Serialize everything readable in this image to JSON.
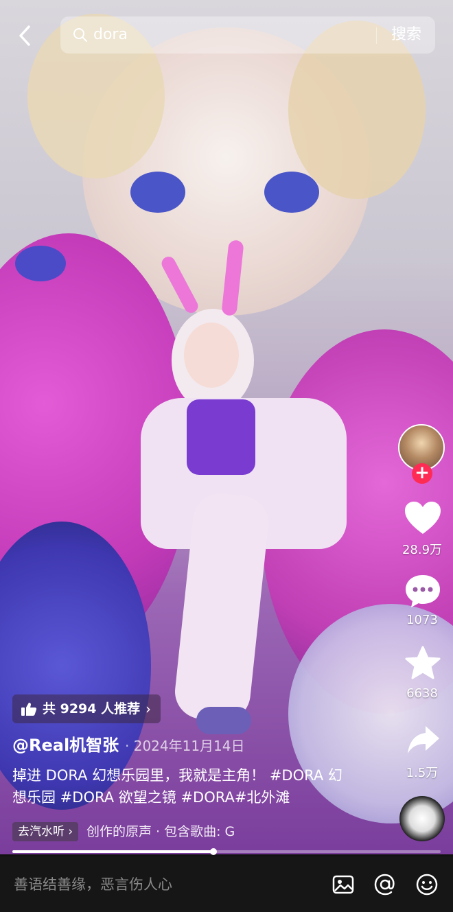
{
  "search": {
    "query": "dora",
    "button": "搜索"
  },
  "rail": {
    "likes": "28.9万",
    "comments": "1073",
    "favorites": "6638",
    "shares": "1.5万"
  },
  "recommend": {
    "label": "共 9294 人推荐"
  },
  "post": {
    "author": "@Real机智张",
    "date": "· 2024年11月14日",
    "description": "掉进 DORA 幻想乐园里，我就是主角！ #DORA 幻想乐园 #DORA 欲望之镜 #DORA#北外滩"
  },
  "music": {
    "tag": "去汽水听 ›",
    "text": "创作的原声 · 包含歌曲: G"
  },
  "progress": {
    "fraction": 0.47
  },
  "comment_bar": {
    "placeholder": "善语结善缘，恶言伤人心"
  },
  "icons": {
    "back": "chevron-left-icon",
    "search": "search-icon",
    "like": "heart-icon",
    "comment": "comment-bubble-icon",
    "favorite": "star-icon",
    "share": "share-arrow-icon",
    "image": "image-icon",
    "mention": "at-icon",
    "emoji": "emoji-icon"
  },
  "colors": {
    "follow": "#fe2c55",
    "bar": "#161616"
  }
}
